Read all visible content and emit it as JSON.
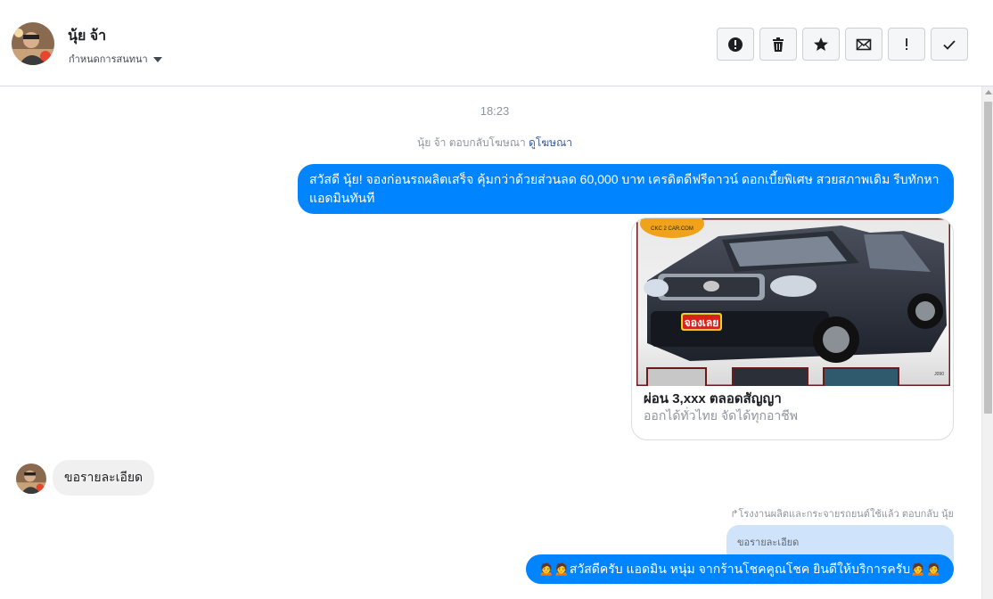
{
  "header": {
    "contact_name": "นุ้ย จ้า",
    "assign_label": "กำหนดการสนทนา",
    "toolbar": [
      {
        "icon": "alert-circle-icon",
        "name": "spam-button"
      },
      {
        "icon": "trash-icon",
        "name": "delete-button"
      },
      {
        "icon": "star-icon",
        "name": "star-button"
      },
      {
        "icon": "mail-icon",
        "name": "mark-unread-button"
      },
      {
        "icon": "exclamation-icon",
        "name": "follow-up-button"
      },
      {
        "icon": "check-icon",
        "name": "mark-done-button"
      }
    ]
  },
  "conversation": {
    "timestamp": "18:23",
    "ad_reply_text": "นุ้ย จ้า ตอบกลับโฆษณา ",
    "ad_link": "ดูโฆษณา",
    "outgoing_message_1": "สวัสดี นุ้ย! จองก่อนรถผลิตเสร็จ คุ้มกว่าด้วยส่วนลด 60,000 บาท เครดิตดีฟรีดาวน์ ดอกเบี้ยพิเศษ สวยสภาพเดิม รีบทักหาแอดมินทันที",
    "ad_card": {
      "image_logo": "CKC 2 CAR.COM",
      "image_sticker": "จองเลย",
      "image_watermark": "J090",
      "title": "ผ่อน 3,xxx ตลอดสัญญา",
      "subtitle": "ออกได้ทั่วไทย จัดได้ทุกอาชีพ"
    },
    "incoming_message": "ขอรายละเอียด",
    "reply_note": "โรงงานผลิตและกระจายรถยนต์ใช้แล้ว ตอบกลับ นุ้ย",
    "quoted_text": "ขอรายละเอียด",
    "outgoing_message_2": "🙍🙍สวัสดีครับ แอดมิน หนุ่ม จากร้านโชคคูณโชค ยินดีให้บริการครับ🙍🙍"
  },
  "colors": {
    "messenger_blue": "#0084ff",
    "incoming_bubble": "#f1f0f0",
    "quoted_bubble": "#cfe4fb",
    "link": "#365899"
  }
}
